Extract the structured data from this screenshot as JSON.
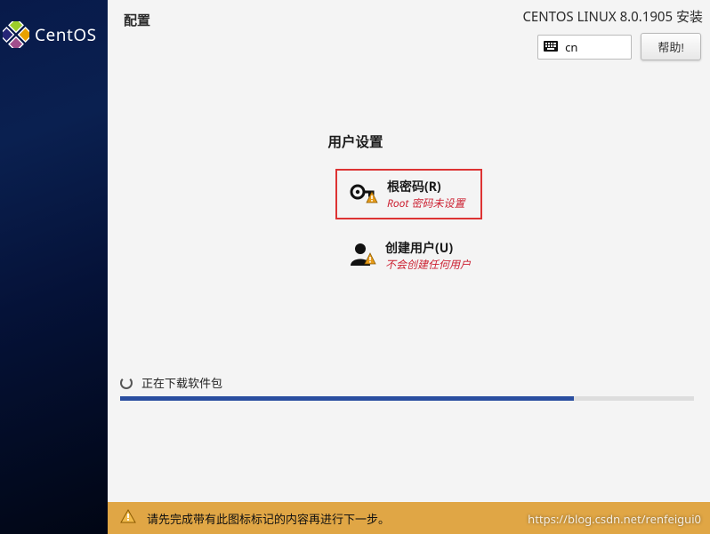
{
  "sidebar": {
    "brand": "CentOS"
  },
  "topbar": {
    "page_title": "配置",
    "install_title": "CENTOS LINUX 8.0.1905 安装",
    "lang_code": "cn",
    "help_label": "帮助!"
  },
  "user_settings": {
    "section_title": "用户设置",
    "root": {
      "title": "根密码(R)",
      "subtitle": "Root 密码未设置"
    },
    "create_user": {
      "title": "创建用户(U)",
      "subtitle": "不会创建任何用户"
    }
  },
  "progress": {
    "status_text": "正在下载软件包",
    "percent": 79
  },
  "bottombar": {
    "message": "请先完成带有此图标标记的内容再进行下一步。"
  },
  "watermark": "https://blog.csdn.net/renfeigui0"
}
